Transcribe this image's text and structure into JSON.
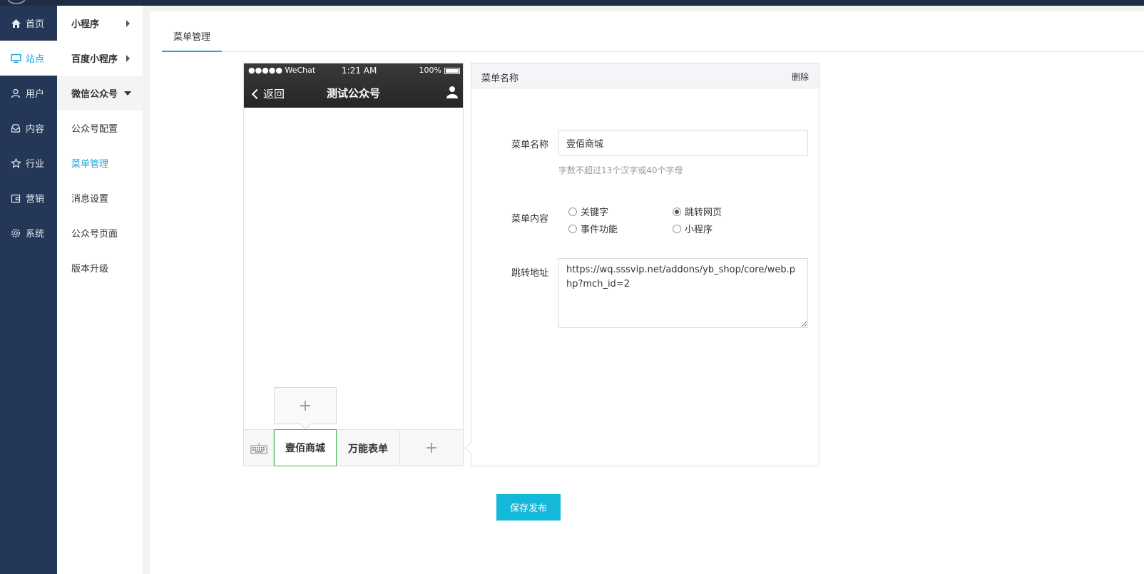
{
  "primary_nav": {
    "items": [
      {
        "label": "首页",
        "icon": "home-icon"
      },
      {
        "label": "站点",
        "icon": "monitor-icon",
        "active": true
      },
      {
        "label": "用户",
        "icon": "user-icon"
      },
      {
        "label": "内容",
        "icon": "inbox-icon"
      },
      {
        "label": "行业",
        "icon": "star-icon"
      },
      {
        "label": "营销",
        "icon": "wallet-icon"
      },
      {
        "label": "系统",
        "icon": "gear-icon"
      }
    ]
  },
  "secondary_nav": {
    "items": [
      {
        "label": "小程序"
      },
      {
        "label": "百度小程序"
      },
      {
        "label": "微信公众号"
      },
      {
        "label": "公众号配置"
      },
      {
        "label": "菜单管理",
        "active": true
      },
      {
        "label": "消息设置"
      },
      {
        "label": "公众号页面"
      },
      {
        "label": "版本升级"
      }
    ]
  },
  "tabs": {
    "active_label": "菜单管理"
  },
  "phone": {
    "carrier": "●●●●● WeChat",
    "time": "1:21 AM",
    "battery": "100%",
    "back_label": "返回",
    "title": "测试公众号",
    "menu_items": [
      "壹佰商城",
      "万能表单"
    ],
    "add_glyph": "+",
    "submenu_add_glyph": "+"
  },
  "editor": {
    "header_title": "菜单名称",
    "delete_label": "删除",
    "name_label": "菜单名称",
    "name_value": "壹佰商城",
    "name_hint": "字数不超过13个汉字或40个字母",
    "content_label": "菜单内容",
    "options": [
      "关键字",
      "跳转网页",
      "事件功能",
      "小程序"
    ],
    "selected_option": "跳转网页",
    "url_label": "跳转地址",
    "url_value": "https://wq.sssvip.net/addons/yb_shop/core/web.php?mch_id=2"
  },
  "actions": {
    "save_label": "保存发布"
  },
  "colors": {
    "accent": "#1aa6e0",
    "sidebar": "#253756",
    "save_button": "#14b8d8",
    "menu_selected_border": "#44b549"
  }
}
